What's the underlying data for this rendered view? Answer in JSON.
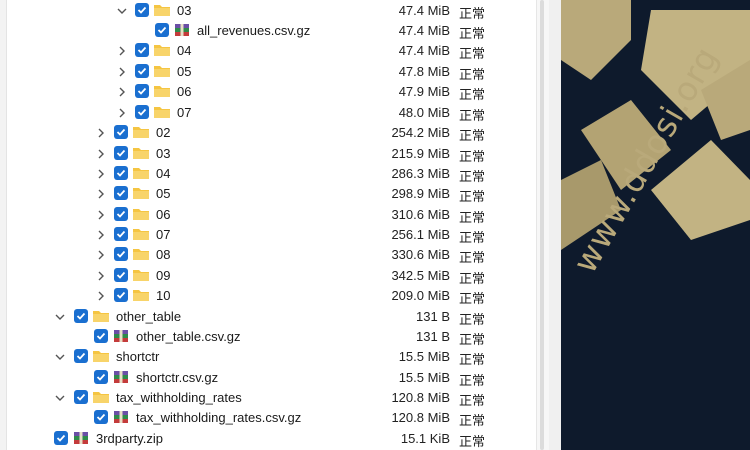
{
  "tree": {
    "rows": [
      {
        "name": "03",
        "size": "47.4 MiB",
        "status": "正常",
        "type": "folder",
        "expanded": true
      },
      {
        "name": "all_revenues.csv.gz",
        "size": "47.4 MiB",
        "status": "正常",
        "type": "archive"
      },
      {
        "name": "04",
        "size": "47.4 MiB",
        "status": "正常",
        "type": "folder",
        "expanded": false
      },
      {
        "name": "05",
        "size": "47.8 MiB",
        "status": "正常",
        "type": "folder",
        "expanded": false
      },
      {
        "name": "06",
        "size": "47.9 MiB",
        "status": "正常",
        "type": "folder",
        "expanded": false
      },
      {
        "name": "07",
        "size": "48.0 MiB",
        "status": "正常",
        "type": "folder",
        "expanded": false
      },
      {
        "name": "02",
        "size": "254.2 MiB",
        "status": "正常",
        "type": "folder",
        "expanded": false
      },
      {
        "name": "03",
        "size": "215.9 MiB",
        "status": "正常",
        "type": "folder",
        "expanded": false
      },
      {
        "name": "04",
        "size": "286.3 MiB",
        "status": "正常",
        "type": "folder",
        "expanded": false
      },
      {
        "name": "05",
        "size": "298.9 MiB",
        "status": "正常",
        "type": "folder",
        "expanded": false
      },
      {
        "name": "06",
        "size": "310.6 MiB",
        "status": "正常",
        "type": "folder",
        "expanded": false
      },
      {
        "name": "07",
        "size": "256.1 MiB",
        "status": "正常",
        "type": "folder",
        "expanded": false
      },
      {
        "name": "08",
        "size": "330.6 MiB",
        "status": "正常",
        "type": "folder",
        "expanded": false
      },
      {
        "name": "09",
        "size": "342.5 MiB",
        "status": "正常",
        "type": "folder",
        "expanded": false
      },
      {
        "name": "10",
        "size": "209.0 MiB",
        "status": "正常",
        "type": "folder",
        "expanded": false
      },
      {
        "name": "other_table",
        "size": "131 B",
        "status": "正常",
        "type": "folder",
        "expanded": true
      },
      {
        "name": "other_table.csv.gz",
        "size": "131 B",
        "status": "正常",
        "type": "archive"
      },
      {
        "name": "shortctr",
        "size": "15.5 MiB",
        "status": "正常",
        "type": "folder",
        "expanded": true
      },
      {
        "name": "shortctr.csv.gz",
        "size": "15.5 MiB",
        "status": "正常",
        "type": "archive"
      },
      {
        "name": "tax_withholding_rates",
        "size": "120.8 MiB",
        "status": "正常",
        "type": "folder",
        "expanded": true
      },
      {
        "name": "tax_withholding_rates.csv.gz",
        "size": "120.8 MiB",
        "status": "正常",
        "type": "archive"
      },
      {
        "name": "3rdparty.zip",
        "size": "15.1 KiB",
        "status": "正常",
        "type": "archive"
      }
    ]
  },
  "wallpaper": {
    "watermark": "www.ddosi.org"
  },
  "colors": {
    "checkbox": "#1a6fd0",
    "folder": "#f5c542",
    "wallpaper_bg": "#0e1a2c",
    "wallpaper_accent": "#b9a97a"
  }
}
